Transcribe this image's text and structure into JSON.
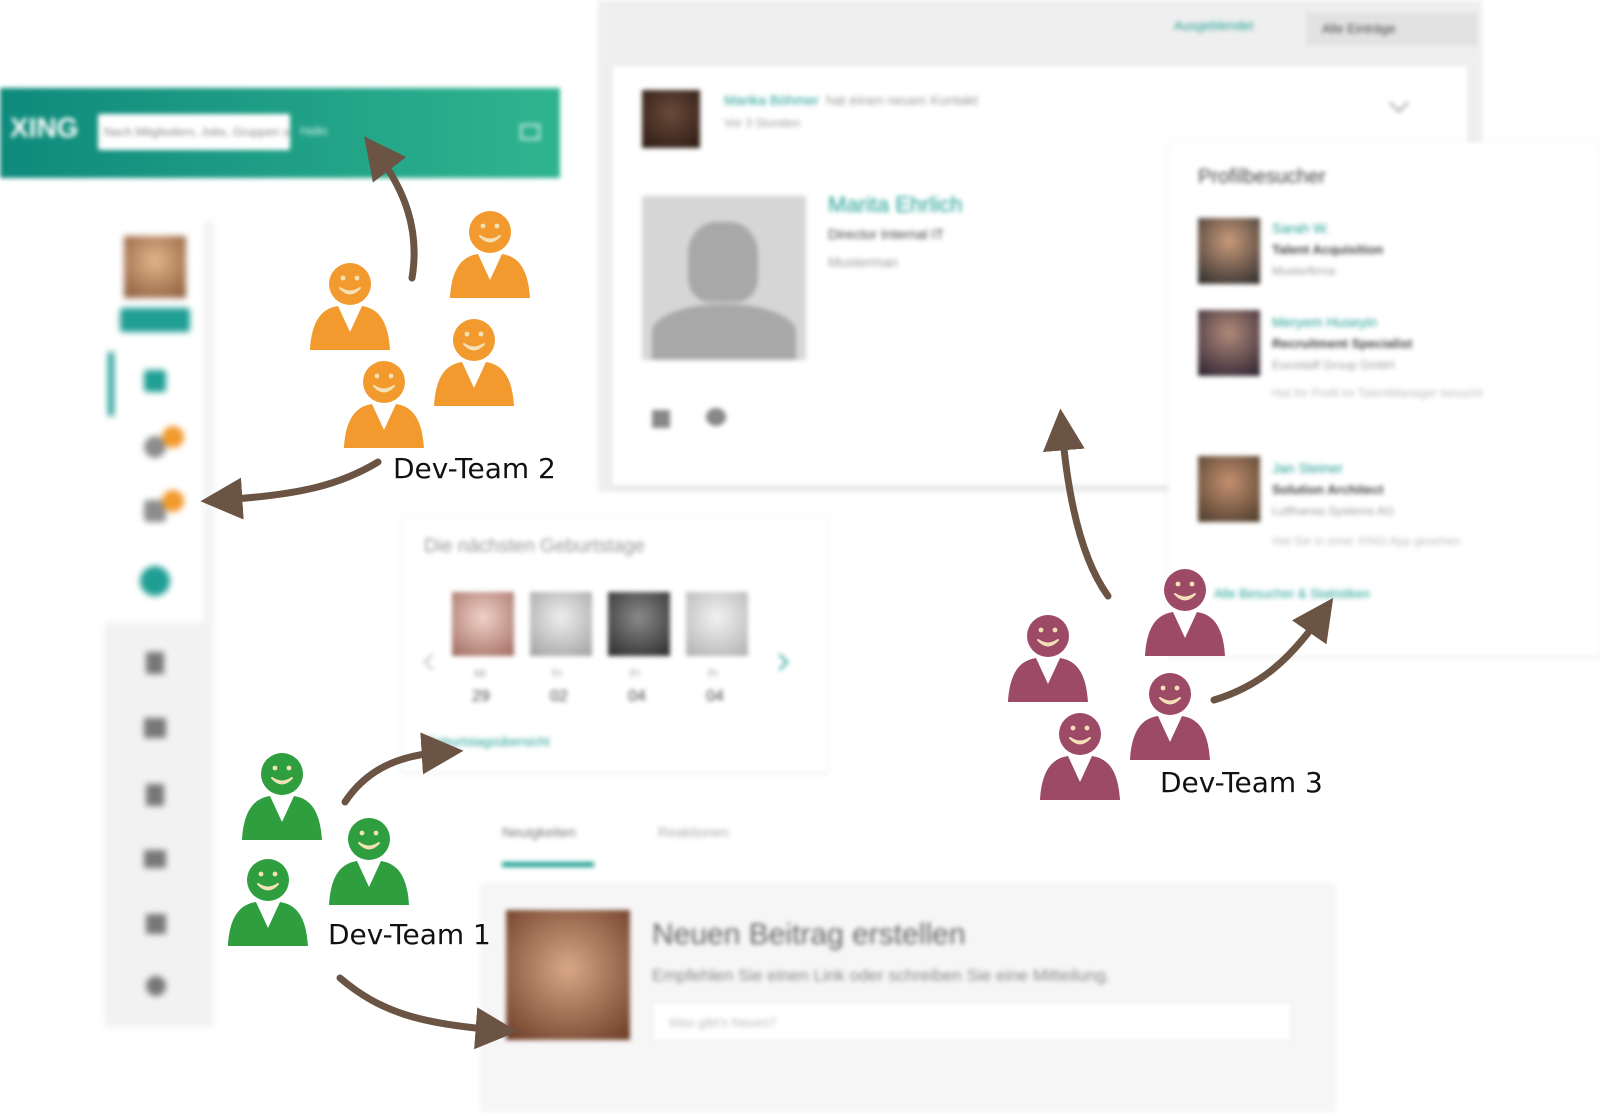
{
  "colors": {
    "team1": "#2e9e3f",
    "team2": "#f29a2e",
    "team3": "#9c4a66",
    "arrow": "#6b5443",
    "brand": "#1f9f94"
  },
  "teams": [
    {
      "label": "Dev-Team 1",
      "color": "#2e9e3f"
    },
    {
      "label": "Dev-Team 2",
      "color": "#f29a2e"
    },
    {
      "label": "Dev-Team 3",
      "color": "#9c4a66"
    }
  ],
  "header": {
    "logo": "XING",
    "search_placeholder": "Nach Mitgliedern, Jobs, Gruppen suchen",
    "search_hint": "Hallo",
    "icon": "mail-icon"
  },
  "sidebar": {
    "icons": [
      "home-icon",
      "contacts-icon",
      "messages-icon",
      "plus-icon",
      "person-icon",
      "grid-icon",
      "document-icon",
      "chart-icon",
      "shop-icon",
      "gear-icon"
    ]
  },
  "feed": {
    "filter_link": "Ausgeblendet",
    "filter_select": "Alle Einträge",
    "post_author": "Marika Böhmer",
    "post_text": "hat einen neuen Kontakt",
    "post_time": "Vor 3 Stunden",
    "contact_name": "Marita Ehrlich",
    "contact_title": "Director Internal IT",
    "contact_company": "Musterman"
  },
  "visitors": {
    "title": "Profilbesucher",
    "items": [
      {
        "name": "Sarah W.",
        "role": "Talent Acquisition",
        "company": "Musterfirma",
        "note": ""
      },
      {
        "name": "Meryem Huseyin",
        "role": "Recruitment Specialist",
        "company": "Eurostaff Group GmbH",
        "note": "Hat Ihr Profil im TalentManager besucht"
      },
      {
        "name": "Jan Steiner",
        "role": "Solution Architect",
        "company": "Lufthansa Systems AG",
        "note": "Hat Sie in einer XING App gesehen"
      }
    ],
    "footer_link": "Alle Besucher & Statistiken"
  },
  "birthdays": {
    "title": "Die nächsten Geburtstage",
    "people": [
      {
        "day": "Mi",
        "date": "29"
      },
      {
        "day": "Fr",
        "date": "02"
      },
      {
        "day": "Fr",
        "date": "04"
      },
      {
        "day": "Fr",
        "date": "04"
      }
    ],
    "footer_link": "Geburtstagsübersicht"
  },
  "compose": {
    "tabs": [
      "Neuigkeiten",
      "Reaktionen"
    ],
    "title": "Neuen Beitrag erstellen",
    "subtitle": "Empfehlen Sie einen Link oder schreiben Sie eine Mitteilung.",
    "input_placeholder": "Was gibt's Neues?"
  }
}
